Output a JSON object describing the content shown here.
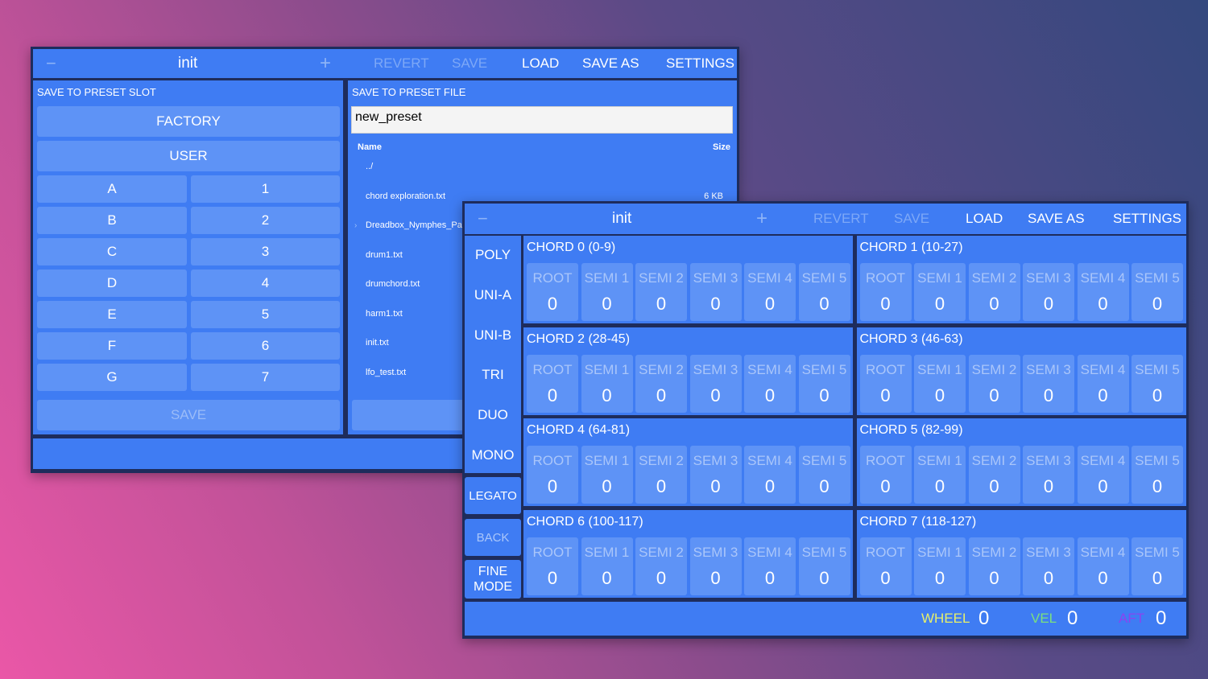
{
  "colors": {
    "panel_blue": "#3f7cf3",
    "button_blue": "#5e93f6",
    "dim_text": "#7da8f7",
    "wheel": "#e7f06a",
    "vel": "#7be07e",
    "aft": "#8a44f0"
  },
  "window1": {
    "topbar": {
      "minus_icon": "−",
      "title": "init",
      "plus_icon": "+",
      "revert": "REVERT",
      "save": "SAVE",
      "load": "LOAD",
      "save_as": "SAVE AS",
      "settings": "SETTINGS"
    },
    "slot": {
      "label": "SAVE TO PRESET SLOT",
      "factory": "FACTORY",
      "user": "USER",
      "letters": [
        "A",
        "B",
        "C",
        "D",
        "E",
        "F",
        "G"
      ],
      "numbers": [
        "1",
        "2",
        "3",
        "4",
        "5",
        "6",
        "7"
      ],
      "save": "SAVE"
    },
    "file": {
      "label": "SAVE TO PRESET FILE",
      "filename_value": "new_preset",
      "header_name": "Name",
      "header_size": "Size",
      "rows": [
        {
          "name": "../",
          "size": ""
        },
        {
          "name": "chord exploration.txt",
          "size": "6 KB"
        },
        {
          "name": "Dreadbox_Nymphes_Pa",
          "size": ""
        },
        {
          "name": "drum1.txt",
          "size": ""
        },
        {
          "name": "drumchord.txt",
          "size": ""
        },
        {
          "name": "harm1.txt",
          "size": ""
        },
        {
          "name": "init.txt",
          "size": ""
        },
        {
          "name": "lfo_test.txt",
          "size": ""
        }
      ]
    }
  },
  "window2": {
    "topbar": {
      "minus_icon": "−",
      "title": "init",
      "plus_icon": "+",
      "revert": "REVERT",
      "save": "SAVE",
      "load": "LOAD",
      "save_as": "SAVE AS",
      "settings": "SETTINGS"
    },
    "modes": [
      "POLY",
      "UNI-A",
      "UNI-B",
      "TRI",
      "DUO",
      "MONO"
    ],
    "legato": "LEGATO",
    "back": "BACK",
    "fine_mode": "FINE MODE",
    "cell_labels": [
      "ROOT",
      "SEMI 1",
      "SEMI 2",
      "SEMI 3",
      "SEMI 4",
      "SEMI 5"
    ],
    "chords": [
      {
        "title": "CHORD 0 (0-9)",
        "values": [
          "0",
          "0",
          "0",
          "0",
          "0",
          "0"
        ]
      },
      {
        "title": "CHORD 1 (10-27)",
        "values": [
          "0",
          "0",
          "0",
          "0",
          "0",
          "0"
        ]
      },
      {
        "title": "CHORD 2 (28-45)",
        "values": [
          "0",
          "0",
          "0",
          "0",
          "0",
          "0"
        ]
      },
      {
        "title": "CHORD 3 (46-63)",
        "values": [
          "0",
          "0",
          "0",
          "0",
          "0",
          "0"
        ]
      },
      {
        "title": "CHORD 4 (64-81)",
        "values": [
          "0",
          "0",
          "0",
          "0",
          "0",
          "0"
        ]
      },
      {
        "title": "CHORD 5 (82-99)",
        "values": [
          "0",
          "0",
          "0",
          "0",
          "0",
          "0"
        ]
      },
      {
        "title": "CHORD 6 (100-117)",
        "values": [
          "0",
          "0",
          "0",
          "0",
          "0",
          "0"
        ]
      },
      {
        "title": "CHORD 7 (118-127)",
        "values": [
          "0",
          "0",
          "0",
          "0",
          "0",
          "0"
        ]
      }
    ],
    "status": {
      "wheel_label": "WHEEL",
      "wheel_value": "0",
      "vel_label": "VEL",
      "vel_value": "0",
      "aft_label": "AFT",
      "aft_value": "0"
    }
  }
}
